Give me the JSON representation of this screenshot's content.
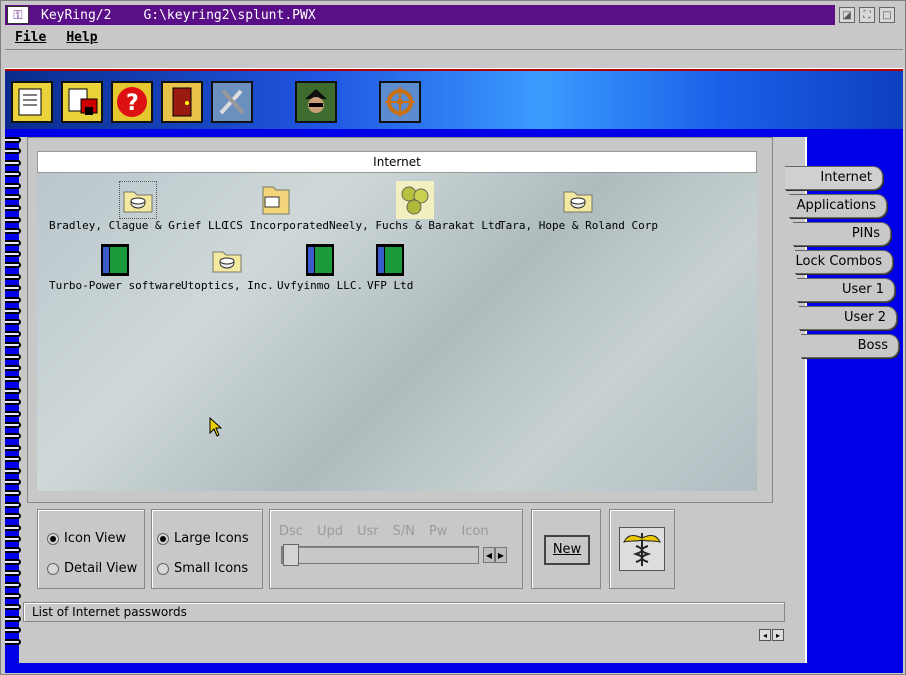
{
  "window": {
    "app_title": "KeyRing/2",
    "file_path": "G:\\keyring2\\splunt.PWX"
  },
  "menu": [
    {
      "label": "File"
    },
    {
      "label": "Help"
    }
  ],
  "toolbar": {
    "buttons": [
      {
        "icon": "notes-icon"
      },
      {
        "icon": "print-icon"
      },
      {
        "icon": "help-question-icon"
      },
      {
        "icon": "exit-door-icon"
      },
      {
        "icon": "tools-icon"
      },
      {
        "icon": "spy-icon"
      },
      {
        "icon": "ships-wheel-icon"
      }
    ]
  },
  "folder": {
    "title": "Internet",
    "items": [
      {
        "label": "Bradley, Clague & Grief LLC",
        "icon": "folder-disk-icon"
      },
      {
        "label": "ICS Incorporated",
        "icon": "folder-open-icon"
      },
      {
        "label": "Neely, Fuchs & Barakat Ltd",
        "icon": "coins-icon"
      },
      {
        "label": "Tara, Hope & Roland Corp",
        "icon": "folder-disk-icon"
      },
      {
        "label": "Turbo-Power software",
        "icon": "book-icon"
      },
      {
        "label": "Utoptics, Inc.",
        "icon": "folder-disk-icon"
      },
      {
        "label": "Uvfyinmo LLC.",
        "icon": "book-icon"
      },
      {
        "label": "VFP Ltd",
        "icon": "book-icon"
      }
    ]
  },
  "tabs": [
    {
      "label": "Internet",
      "selected": true
    },
    {
      "label": "Applications"
    },
    {
      "label": "PINs"
    },
    {
      "label": "Lock Combos"
    },
    {
      "label": "User 1"
    },
    {
      "label": "User 2"
    },
    {
      "label": "Boss"
    }
  ],
  "view": {
    "icon_view": "Icon View",
    "detail_view": "Detail View",
    "large_icons": "Large Icons",
    "small_icons": "Small Icons",
    "selected_view": "Icon View",
    "selected_size": "Large Icons"
  },
  "columns": [
    "Dsc",
    "Upd",
    "Usr",
    "S/N",
    "Pw",
    "Icon"
  ],
  "new_button": "New",
  "status_text": "List of Internet passwords",
  "colors": {
    "title_bar": "#5a0f88",
    "notebook_blue": "#0000e8"
  }
}
